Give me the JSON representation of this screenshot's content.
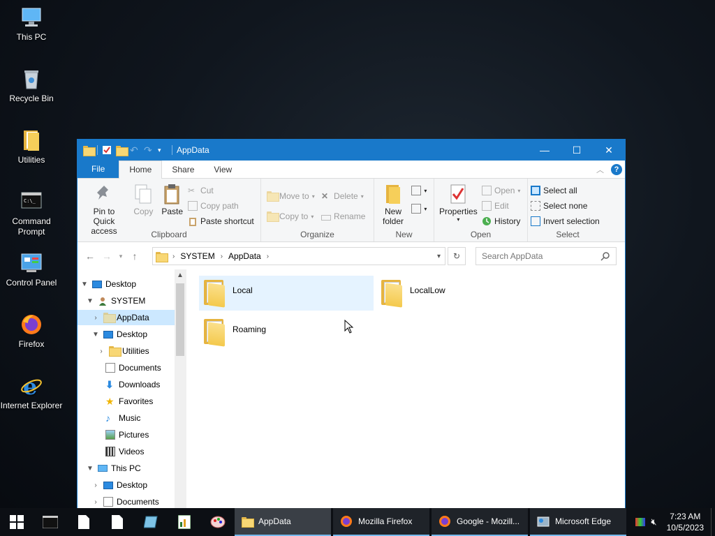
{
  "desktop": {
    "icons": [
      {
        "label": "This PC"
      },
      {
        "label": "Recycle Bin"
      },
      {
        "label": "Utilities"
      },
      {
        "label": "Command Prompt"
      },
      {
        "label": "Control Panel"
      },
      {
        "label": "Firefox"
      },
      {
        "label": "Internet Explorer"
      }
    ]
  },
  "window": {
    "title": "AppData",
    "controls": {
      "minimize": "—",
      "maximize": "☐",
      "close": "✕"
    }
  },
  "ribbon": {
    "tabs": [
      "File",
      "Home",
      "Share",
      "View"
    ],
    "clipboard": {
      "label": "Clipboard",
      "pin": "Pin to Quick access",
      "copy": "Copy",
      "paste": "Paste",
      "cut": "Cut",
      "copy_path": "Copy path",
      "paste_shortcut": "Paste shortcut"
    },
    "organize": {
      "label": "Organize",
      "move_to": "Move to",
      "copy_to": "Copy to",
      "delete": "Delete",
      "rename": "Rename"
    },
    "new": {
      "label": "New",
      "new_folder": "New folder"
    },
    "open": {
      "label": "Open",
      "properties": "Properties",
      "open": "Open",
      "edit": "Edit",
      "history": "History"
    },
    "select": {
      "label": "Select",
      "select_all": "Select all",
      "select_none": "Select none",
      "invert": "Invert selection"
    }
  },
  "address": {
    "path": [
      "SYSTEM",
      "AppData"
    ],
    "search_placeholder": "Search AppData"
  },
  "nav_tree": [
    {
      "label": "Desktop",
      "expanded": true
    },
    {
      "label": "SYSTEM",
      "expanded": true
    },
    {
      "label": "AppData",
      "selected": true
    },
    {
      "label": "Desktop",
      "expanded": true
    },
    {
      "label": "Utilities"
    },
    {
      "label": "Documents"
    },
    {
      "label": "Downloads"
    },
    {
      "label": "Favorites"
    },
    {
      "label": "Music"
    },
    {
      "label": "Pictures"
    },
    {
      "label": "Videos"
    },
    {
      "label": "This PC",
      "expanded": true
    },
    {
      "label": "Desktop"
    },
    {
      "label": "Documents"
    }
  ],
  "files": [
    {
      "name": "Local"
    },
    {
      "name": "LocalLow"
    },
    {
      "name": "Roaming"
    }
  ],
  "taskbar": {
    "buttons": [
      {
        "label": "AppData"
      },
      {
        "label": "Mozilla Firefox"
      },
      {
        "label": "Google - Mozill..."
      },
      {
        "label": "Microsoft Edge"
      }
    ],
    "time": "7:23 AM",
    "date": "10/5/2023"
  },
  "colors": {
    "accent": "#1979ca",
    "selection": "#cce8ff",
    "hover": "#e5f3ff",
    "folder": "#f8d775"
  }
}
